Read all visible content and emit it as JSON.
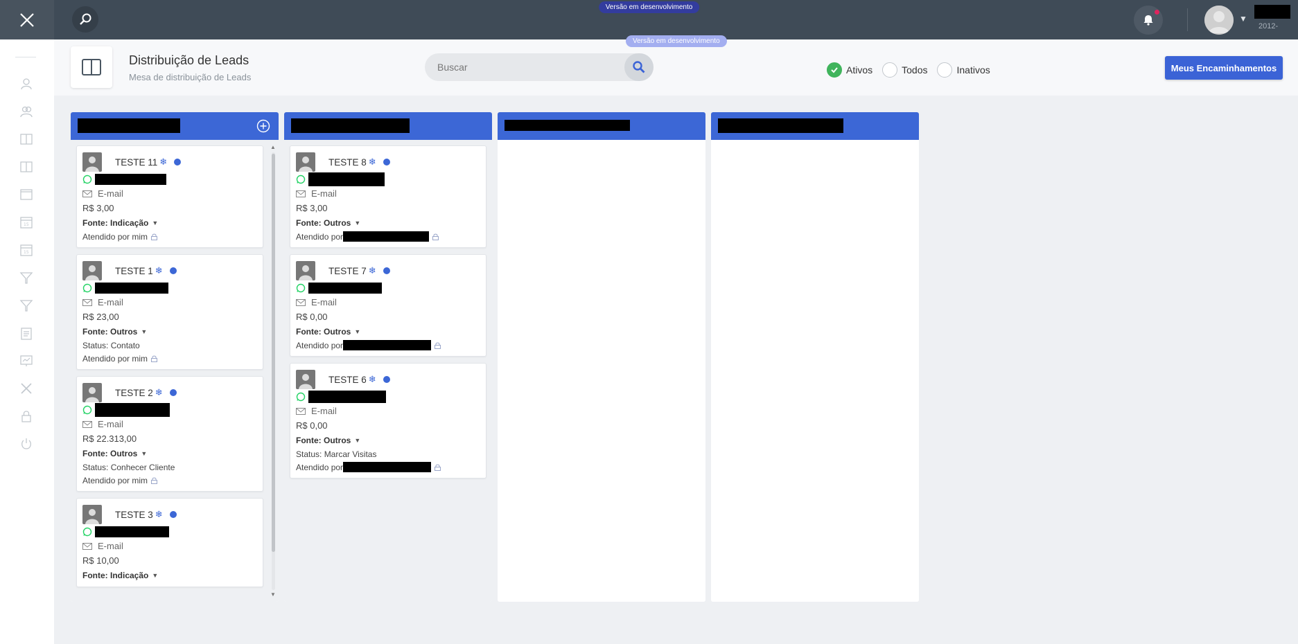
{
  "topbar": {
    "dev_badge": "Versão em desenvolvimento",
    "user_sub": "2012-"
  },
  "header": {
    "title": "Distribuição de Leads",
    "subtitle": "Mesa de distribuição de Leads",
    "search_placeholder": "Buscar",
    "dev_badge": "Versão em desenvolvimento",
    "filters": [
      {
        "label": "Ativos",
        "checked": true
      },
      {
        "label": "Todos",
        "checked": false
      },
      {
        "label": "Inativos",
        "checked": false
      }
    ],
    "primary_button": "Meus Encaminhamentos"
  },
  "columns": [
    {
      "cards": [
        {
          "name": "TESTE 11",
          "email": "E-mail",
          "value": "R$ 3,00",
          "fonte_label": "Fonte:",
          "fonte": "Indicação",
          "status": "",
          "atendido": "Atendido por mim"
        },
        {
          "name": "TESTE 1",
          "email": "E-mail",
          "value": "R$ 23,00",
          "fonte_label": "Fonte:",
          "fonte": "Outros",
          "status": "Status: Contato",
          "atendido": "Atendido por mim"
        },
        {
          "name": "TESTE 2",
          "email": "E-mail",
          "value": "R$ 22.313,00",
          "fonte_label": "Fonte:",
          "fonte": "Outros",
          "status": "Status: Conhecer Cliente",
          "atendido": "Atendido por mim"
        },
        {
          "name": "TESTE 3",
          "email": "E-mail",
          "value": "R$ 10,00",
          "fonte_label": "Fonte:",
          "fonte": "Indicação",
          "status": "",
          "atendido": ""
        }
      ]
    },
    {
      "cards": [
        {
          "name": "TESTE 8",
          "email": "E-mail",
          "value": "R$ 3,00",
          "fonte_label": "Fonte:",
          "fonte": "Outros",
          "status": "",
          "atendido": "Atendido por"
        },
        {
          "name": "TESTE 7",
          "email": "E-mail",
          "value": "R$ 0,00",
          "fonte_label": "Fonte:",
          "fonte": "Outros",
          "status": "",
          "atendido": "Atendido por"
        },
        {
          "name": "TESTE 6",
          "email": "E-mail",
          "value": "R$ 0,00",
          "fonte_label": "Fonte:",
          "fonte": "Outros",
          "status": "Status: Marcar Visitas",
          "atendido": "Atendido por"
        }
      ]
    },
    {
      "cards": []
    },
    {
      "cards": []
    }
  ],
  "colors": {
    "topbar": "#3f4b57",
    "column_header": "#3c67d6",
    "primary_button": "#3b63d6",
    "radio_checked": "#40b45c",
    "whatsapp": "#25d366"
  }
}
